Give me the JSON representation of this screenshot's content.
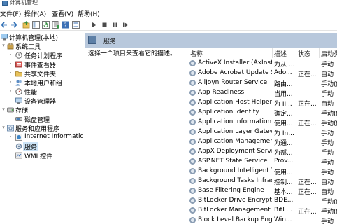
{
  "window": {
    "title": "计算机管理"
  },
  "menu": [
    "文件(F)",
    "操作(A)",
    "查看(V)",
    "帮助(H)"
  ],
  "tree": [
    {
      "label": "计算机管理(本地)",
      "level": 0,
      "arrow": "",
      "icon": "computer-icon"
    },
    {
      "label": "系统工具",
      "level": 1,
      "arrow": "▾",
      "icon": "tools-icon"
    },
    {
      "label": "任务计划程序",
      "level": 2,
      "arrow": "›",
      "icon": "clock-icon"
    },
    {
      "label": "事件查看器",
      "level": 2,
      "arrow": "›",
      "icon": "event-viewer-icon"
    },
    {
      "label": "共享文件夹",
      "level": 2,
      "arrow": "›",
      "icon": "shared-folder-icon"
    },
    {
      "label": "本地用户和组",
      "level": 2,
      "arrow": "›",
      "icon": "users-icon"
    },
    {
      "label": "性能",
      "level": 2,
      "arrow": "›",
      "icon": "performance-icon"
    },
    {
      "label": "设备管理器",
      "level": 2,
      "arrow": "",
      "icon": "device-manager-icon"
    },
    {
      "label": "存储",
      "level": 1,
      "arrow": "▾",
      "icon": "storage-icon"
    },
    {
      "label": "磁盘管理",
      "level": 2,
      "arrow": "",
      "icon": "disk-icon"
    },
    {
      "label": "服务和应用程序",
      "level": 1,
      "arrow": "▾",
      "icon": "services-apps-icon"
    },
    {
      "label": "Internet Information S",
      "level": 2,
      "arrow": "›",
      "icon": "iis-icon"
    },
    {
      "label": "服务",
      "level": 2,
      "arrow": "",
      "icon": "services-icon",
      "selected": true
    },
    {
      "label": "WMI 控件",
      "level": 2,
      "arrow": "",
      "icon": "wmi-icon"
    }
  ],
  "panel": {
    "title": "服务",
    "description": "选择一个项目来查看它的描述。",
    "columns": [
      "名称",
      "描述",
      "状态",
      "启动类"
    ]
  },
  "services": [
    {
      "name": "ActiveX Installer (AxInstSV)",
      "desc": "为从 ...",
      "status": "",
      "startup": "手动"
    },
    {
      "name": "Adobe Acrobat Update S...",
      "desc": "Ado...",
      "status": "正在...",
      "startup": "自动"
    },
    {
      "name": "AllJoyn Router Service",
      "desc": "路由...",
      "status": "",
      "startup": "手动(触"
    },
    {
      "name": "App Readiness",
      "desc": "当用...",
      "status": "",
      "startup": "手动"
    },
    {
      "name": "Application Host Helper ...",
      "desc": "为 II...",
      "status": "正在...",
      "startup": "自动"
    },
    {
      "name": "Application Identity",
      "desc": "确定...",
      "status": "",
      "startup": "手动(触"
    },
    {
      "name": "Application Information",
      "desc": "使用...",
      "status": "正在...",
      "startup": "手动(触"
    },
    {
      "name": "Application Layer Gatewa...",
      "desc": "为 In...",
      "status": "",
      "startup": "手动"
    },
    {
      "name": "Application Management",
      "desc": "为通...",
      "status": "",
      "startup": "手动"
    },
    {
      "name": "AppX Deployment Servic...",
      "desc": "为部...",
      "status": "",
      "startup": "手动"
    },
    {
      "name": "ASP.NET State Service",
      "desc": "Prov...",
      "status": "",
      "startup": "手动"
    },
    {
      "name": "Background Intelligent T...",
      "desc": "使用...",
      "status": "",
      "startup": "手动"
    },
    {
      "name": "Background Tasks Infras...",
      "desc": "控制...",
      "status": "正在...",
      "startup": "自动"
    },
    {
      "name": "Base Filtering Engine",
      "desc": "基本...",
      "status": "正在...",
      "startup": "自动"
    },
    {
      "name": "BitLocker Drive Encryptio...",
      "desc": "BDE...",
      "status": "",
      "startup": "手动(触"
    },
    {
      "name": "BitLocker Management C...",
      "desc": "BitL...",
      "status": "正在...",
      "startup": "手动(触"
    },
    {
      "name": "Block Level Backup Engi...",
      "desc": "Win...",
      "status": "",
      "startup": "手动"
    }
  ]
}
